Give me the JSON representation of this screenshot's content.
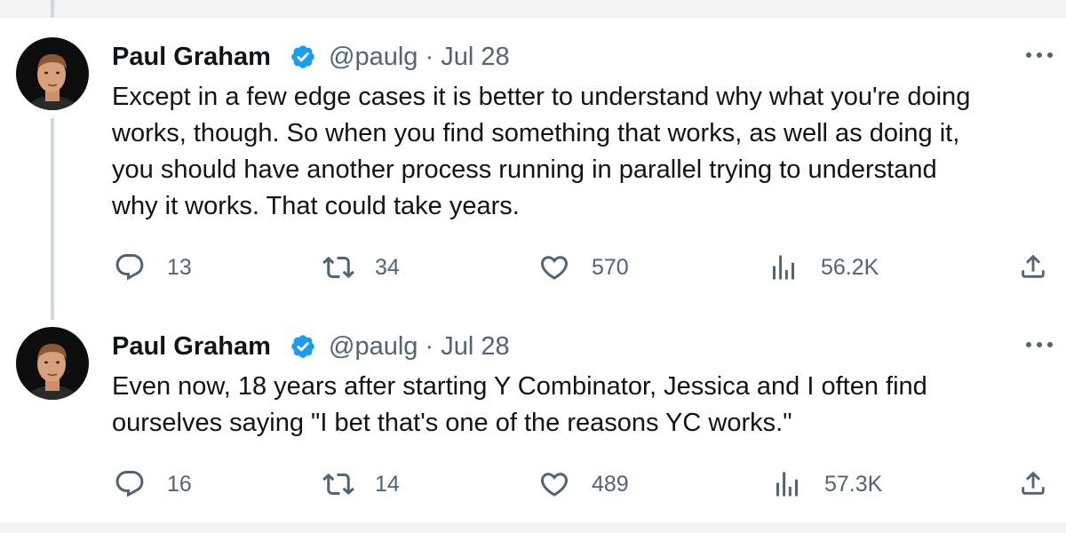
{
  "tweets": [
    {
      "author_name": "Paul Graham",
      "handle": "@paulg",
      "separator": "·",
      "date": "Jul 28",
      "lines": [
        "Except in a few edge cases it is better to understand why what you're doing",
        "works, though. So when you find something that works, as well as doing it,",
        "you should have another process running in parallel trying to understand",
        "why it works. That could take years."
      ],
      "stats": {
        "replies": "13",
        "retweets": "34",
        "likes": "570",
        "views": "56.2K"
      }
    },
    {
      "author_name": "Paul Graham",
      "handle": "@paulg",
      "separator": "·",
      "date": "Jul 28",
      "lines": [
        "Even now, 18 years after starting Y Combinator, Jessica and I often find",
        "ourselves saying \"I bet that's one of the reasons YC works.\""
      ],
      "stats": {
        "replies": "16",
        "retweets": "14",
        "likes": "489",
        "views": "57.3K"
      }
    }
  ],
  "icons": {
    "reply": "reply-icon",
    "retweet": "retweet-icon",
    "like": "heart-icon",
    "views": "views-icon",
    "share": "share-icon",
    "verified": "verified-badge-icon",
    "more": "more-icon"
  },
  "colors": {
    "verified": "#1d9bf0",
    "secondary_text": "#536471",
    "thread_line": "#cfd9de"
  }
}
